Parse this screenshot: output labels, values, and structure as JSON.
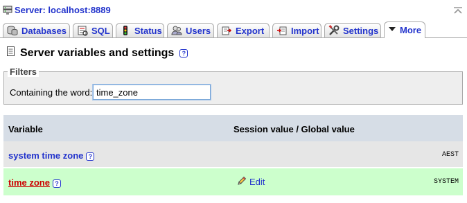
{
  "server": {
    "title": "Server: localhost:8889",
    "icon": "server-icon"
  },
  "tabs": [
    {
      "label": "Databases",
      "icon": "databases-icon"
    },
    {
      "label": "SQL",
      "icon": "sql-icon"
    },
    {
      "label": "Status",
      "icon": "status-icon"
    },
    {
      "label": "Users",
      "icon": "users-icon"
    },
    {
      "label": "Export",
      "icon": "export-icon"
    },
    {
      "label": "Import",
      "icon": "import-icon"
    },
    {
      "label": "Settings",
      "icon": "settings-icon"
    },
    {
      "label": "More",
      "icon": "dropdown-triangle-icon",
      "active": true
    }
  ],
  "page": {
    "title": "Server variables and settings",
    "help": "?"
  },
  "filters": {
    "legend": "Filters",
    "label": "Containing the word:",
    "value": "time_zone"
  },
  "table": {
    "headers": [
      "Variable",
      "Session value / Global value"
    ],
    "rows": [
      {
        "name": "system time zone",
        "edit": "",
        "value": "AEST"
      },
      {
        "name": "time zone",
        "edit": "Edit",
        "value": "SYSTEM"
      }
    ]
  },
  "colors": {
    "link": "#2233cc",
    "marked_row": "#ccffcc",
    "header_bg": "#d6dde6",
    "active_var": "#cc0000"
  }
}
